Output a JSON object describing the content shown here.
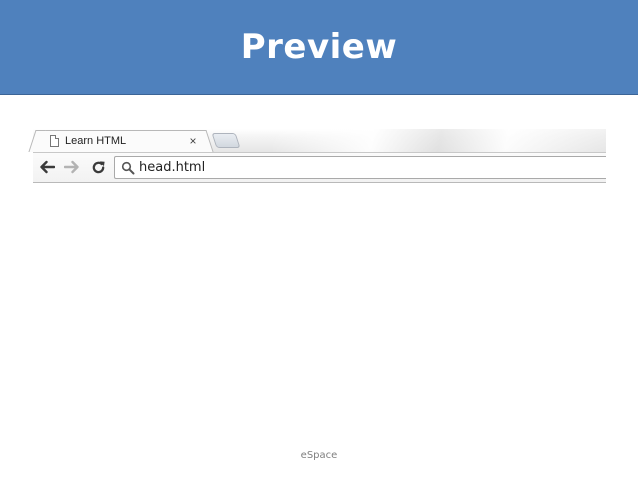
{
  "slide": {
    "title": "Preview",
    "footer": "eSpace"
  },
  "colors": {
    "title_banner": "#4f81bd",
    "title_text": "#ffffff"
  },
  "browser": {
    "active_tab": {
      "icon": "page-icon",
      "title": "Learn HTML",
      "close_label": "×"
    },
    "new_tab_icon": "new-tab-icon",
    "toolbar": {
      "back_icon": "back-arrow-icon",
      "forward_icon": "forward-arrow-icon",
      "reload_icon": "reload-icon"
    },
    "omnibox": {
      "icon": "search-icon",
      "value": "head.html"
    }
  }
}
